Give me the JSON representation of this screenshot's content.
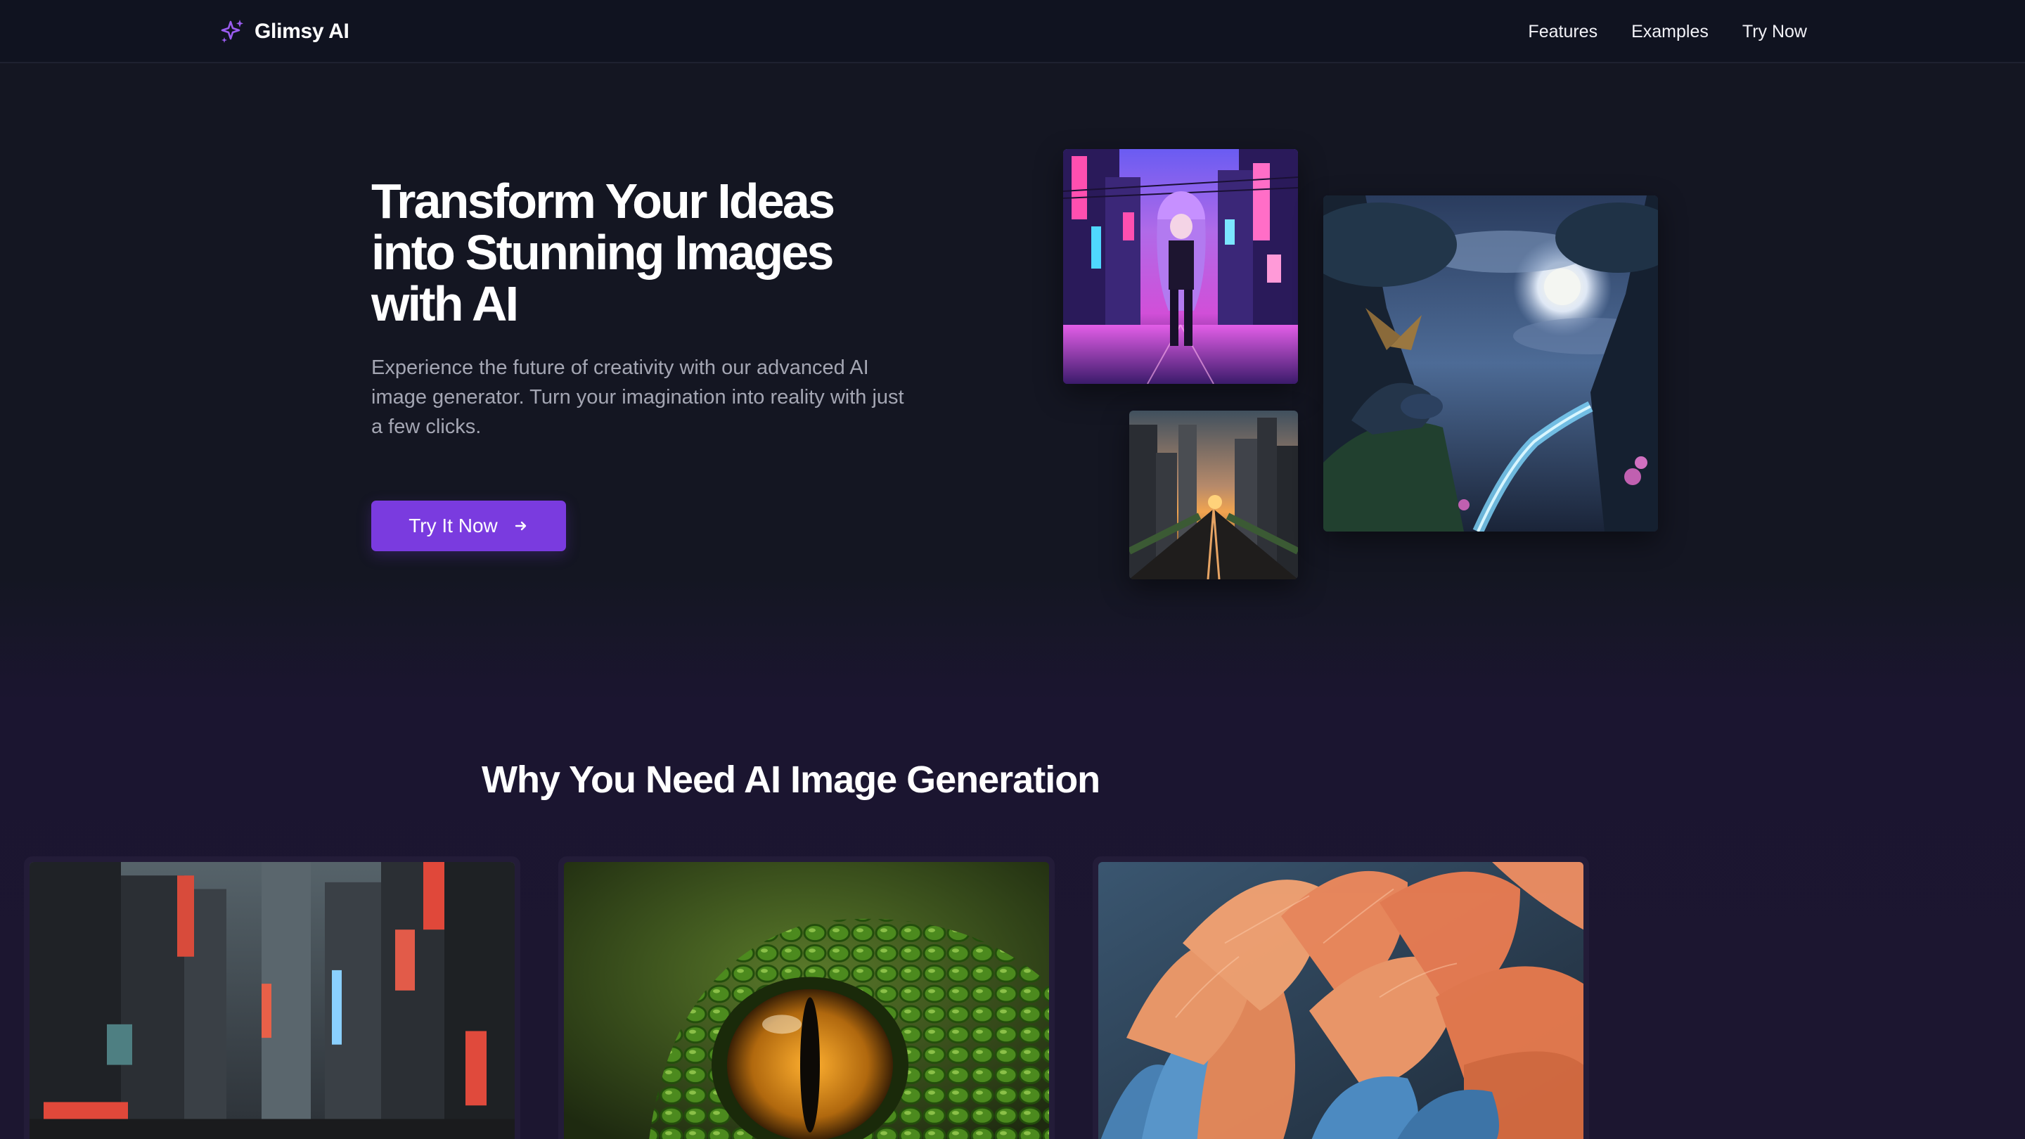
{
  "header": {
    "brand_name": "Glimsy AI",
    "brand_icon": "sparkles-icon",
    "nav": [
      "Features",
      "Examples",
      "Try Now"
    ]
  },
  "hero": {
    "title": "Transform Your Ideas into Stunning Images with AI",
    "subtitle": "Experience the future of creativity with our advanced AI image generator. Turn your imagination into reality with just a few clicks.",
    "cta_label": "Try It Now",
    "cta_icon": "arrow-right-icon",
    "images": [
      "anime-neon-street-image",
      "city-sunset-street-image",
      "dragon-moonlit-forest-image"
    ]
  },
  "section": {
    "title": "Why You Need AI Image Generation",
    "cards": [
      "cyberpunk-city-image",
      "reptile-eye-image",
      "colorful-feathers-image"
    ]
  },
  "colors": {
    "background": "#141622",
    "header": "#101320",
    "accent": "#7a3bdf",
    "muted_text": "#a4a6b3"
  }
}
